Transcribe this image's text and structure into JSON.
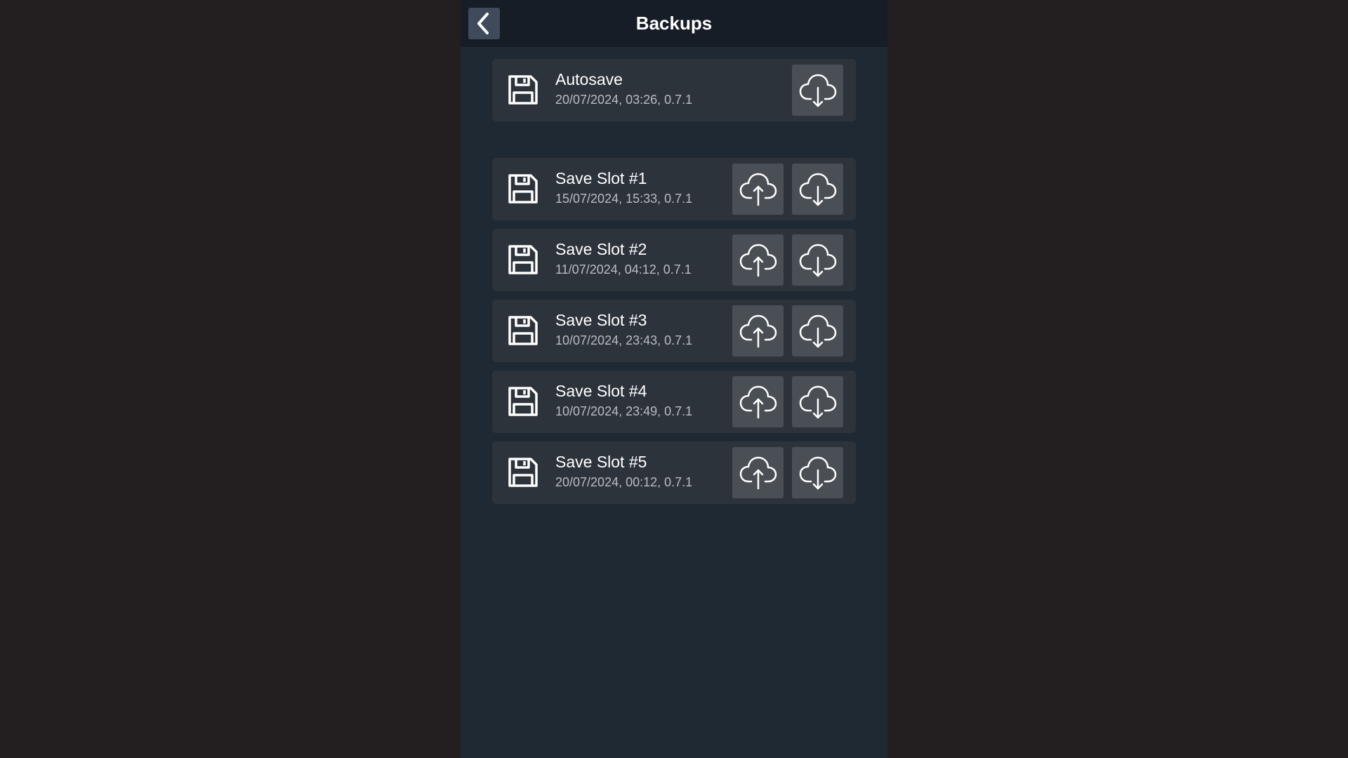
{
  "header": {
    "title": "Backups"
  },
  "autosave": {
    "title": "Autosave",
    "meta": "20/07/2024, 03:26, 0.7.1"
  },
  "slots": [
    {
      "title": "Save Slot #1",
      "meta": "15/07/2024, 15:33, 0.7.1"
    },
    {
      "title": "Save Slot #2",
      "meta": "11/07/2024, 04:12, 0.7.1"
    },
    {
      "title": "Save Slot #3",
      "meta": "10/07/2024, 23:43, 0.7.1"
    },
    {
      "title": "Save Slot #4",
      "meta": "10/07/2024, 23:49, 0.7.1"
    },
    {
      "title": "Save Slot #5",
      "meta": "20/07/2024, 00:12, 0.7.1"
    }
  ],
  "icons": {
    "back": "chevron-left-icon",
    "save": "floppy-disk-icon",
    "upload": "cloud-upload-icon",
    "download": "cloud-download-icon"
  },
  "colors": {
    "outer_background": "#231f20",
    "panel_background": "#1f2933",
    "header_background": "#161d27",
    "card_background": "#2d333b",
    "button_background": "#4a4f56",
    "back_button_background": "#3f4a5a"
  }
}
